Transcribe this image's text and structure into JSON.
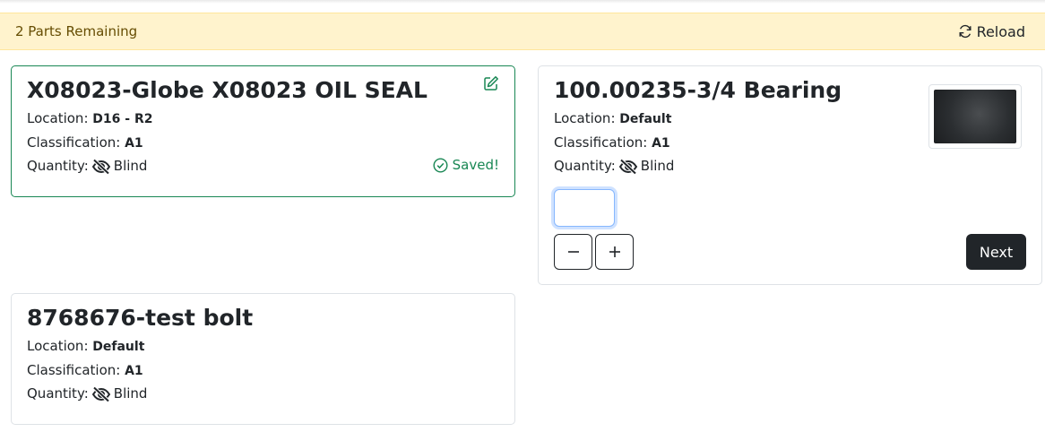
{
  "banner": {
    "text": "2 Parts Remaining",
    "reload_label": "Reload",
    "bg_color": "#fff3cd"
  },
  "cards": [
    {
      "title": "X08023-Globe X08023 OIL SEAL",
      "location_label": "Location:",
      "location_value": "D16 - R2",
      "classification_label": "Classification:",
      "classification_value": "A1",
      "quantity_label": "Quantity:",
      "quantity_value": "Blind",
      "status": "Saved!",
      "status_color": "#198754",
      "icons": [
        "edit-icon",
        "eye-slash-icon",
        "check-circle-icon"
      ]
    },
    {
      "title": "100.00235-3/4 Bearing",
      "location_label": "Location:",
      "location_value": "Default",
      "classification_label": "Classification:",
      "classification_value": "A1",
      "quantity_label": "Quantity:",
      "quantity_value": "Blind",
      "input_value": "",
      "decrement_label": "−",
      "increment_label": "+",
      "next_label": "Next",
      "icons": [
        "eye-slash-icon",
        "minus-icon",
        "plus-icon"
      ]
    },
    {
      "title": "8768676-test bolt",
      "location_label": "Location:",
      "location_value": "Default",
      "classification_label": "Classification:",
      "classification_value": "A1",
      "quantity_label": "Quantity:",
      "quantity_value": "Blind",
      "icons": [
        "eye-slash-icon"
      ]
    }
  ]
}
